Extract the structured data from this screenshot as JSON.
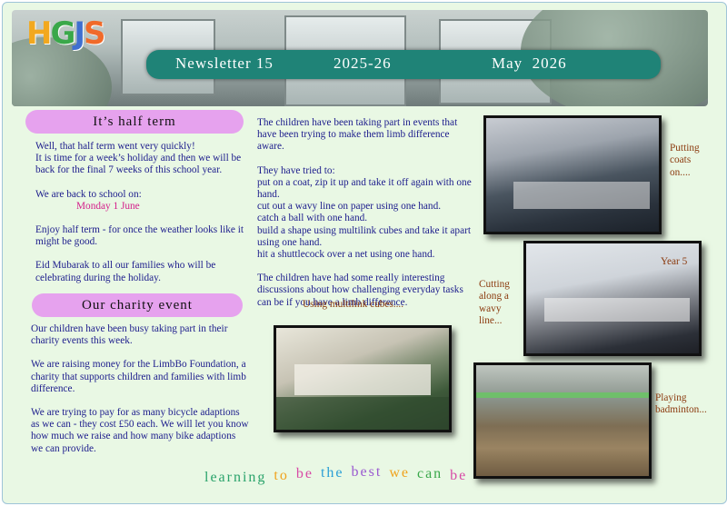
{
  "header": {
    "logo_letters": [
      "H",
      "G",
      "J",
      "S"
    ],
    "logo_colors": [
      "#f2a81e",
      "#3aa84a",
      "#3f6fd0",
      "#f06a2a"
    ],
    "newsletter": "Newsletter 15",
    "year": "2025-26",
    "month": "May  2026"
  },
  "half_term": {
    "heading": "It’s half term",
    "p1a": "Well, that half term went very quickly!",
    "p1b": "It is time for a week’s holiday and then we will be back for the final 7 weeks of this school year.",
    "p2": "We are back to school on:",
    "date": "Monday 1 June",
    "p3": "Enjoy half term - for once the weather looks like it might be good.",
    "p4": "Eid Mubarak to all our families who will be celebrating during the holiday."
  },
  "charity": {
    "heading": "Our charity event",
    "p1": "Our children have been busy taking part in their charity events this week.",
    "p2": "We are raising money for the LimbBo Foundation, a charity that supports children and families with limb difference.",
    "p3": "We are trying to pay for as many bicycle adaptions as we can - they cost £50 each.   We will let you know how much we raise and how many bike adaptions we can provide."
  },
  "limb": {
    "intro": "The  children have been taking part in events that have been trying to make them limb difference aware.",
    "tried": "They have tried to:",
    "items": [
      "put on a coat, zip it up and take it off again with one hand.",
      "cut out a wavy line on paper using one hand.",
      "catch a ball with one hand.",
      "build a shape using multilink cubes and take it apart using one hand.",
      "hit a shuttlecock over a net using one hand."
    ],
    "outro": "The children have had some really interesting discussions about how challenging everyday tasks can be if you have a limb difference.",
    "caption_cubes": "Using multilink cubes...."
  },
  "captions": {
    "coats": "Putting coats on....",
    "cutting": "Cutting along a wavy line...",
    "year5": "Year 5",
    "badminton": "Playing badminton..."
  },
  "motto": {
    "words": [
      "learning",
      "to",
      "be",
      "the",
      "best",
      "we",
      "can",
      "be"
    ],
    "colors": [
      "#2aa36b",
      "#f0a21c",
      "#d84aa6",
      "#2a9fd6",
      "#9a5ad0",
      "#f0a21c",
      "#3aa84a",
      "#d84aa6"
    ]
  }
}
